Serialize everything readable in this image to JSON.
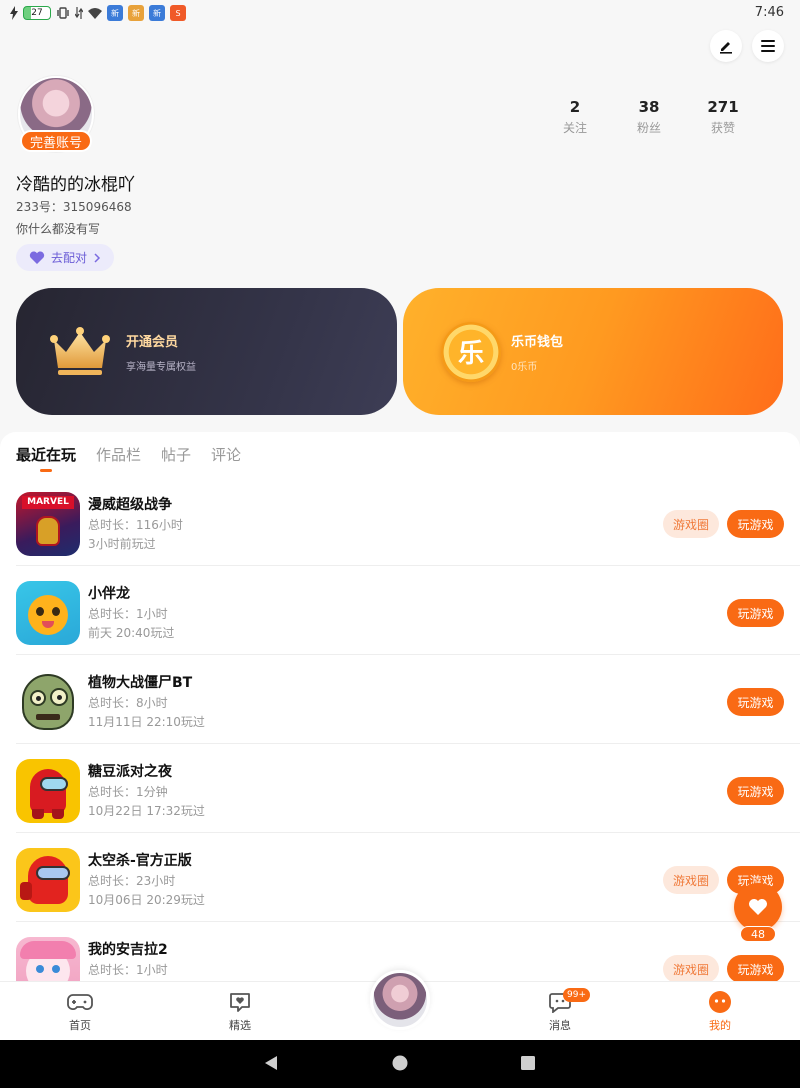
{
  "status_bar": {
    "battery": "27",
    "time": "7:46",
    "icons": [
      "charging-icon",
      "vibrate-icon",
      "data-icon",
      "wifi-icon"
    ],
    "apps": [
      {
        "label": "新",
        "color": "#3b7bd8"
      },
      {
        "label": "新",
        "color": "#e8a23b"
      },
      {
        "label": "新",
        "color": "#3b7bd8"
      },
      {
        "label": "S",
        "color": "#f05a28"
      }
    ]
  },
  "header": {
    "edit_icon": "pencil-icon",
    "menu_icon": "menu-icon"
  },
  "profile": {
    "badge": "完善账号",
    "nickname": "冷酷的的冰棍吖",
    "uid": "233号：315096468",
    "bio": "你什么都没有写",
    "pair_button": "去配对",
    "stats": [
      {
        "value": "2",
        "label": "关注"
      },
      {
        "value": "38",
        "label": "粉丝"
      },
      {
        "value": "271",
        "label": "获赞"
      }
    ]
  },
  "cards": {
    "vip": {
      "title": "开通会员",
      "subtitle": "享海量专属权益"
    },
    "wallet": {
      "title": "乐币钱包",
      "subtitle": "0乐币",
      "coin_char": "乐"
    }
  },
  "tabs": [
    {
      "label": "最近在玩",
      "active": true
    },
    {
      "label": "作品栏",
      "active": false
    },
    {
      "label": "帖子",
      "active": false
    },
    {
      "label": "评论",
      "active": false
    }
  ],
  "games": [
    {
      "name": "漫威超级战争",
      "duration": "总时长：116小时",
      "last_played": "3小时前玩过",
      "has_circle": true
    },
    {
      "name": "小伴龙",
      "duration": "总时长：1小时",
      "last_played": "前天 20:40玩过",
      "has_circle": false
    },
    {
      "name": "植物大战僵尸BT",
      "duration": "总时长：8小时",
      "last_played": "11月11日 22:10玩过",
      "has_circle": false
    },
    {
      "name": "糖豆派对之夜",
      "duration": "总时长：1分钟",
      "last_played": "10月22日 17:32玩过",
      "has_circle": false
    },
    {
      "name": "太空杀-官方正版",
      "duration": "总时长：23小时",
      "last_played": "10月06日 20:29玩过",
      "has_circle": true
    },
    {
      "name": "我的安吉拉2",
      "duration": "总时长：1小时",
      "last_played": "",
      "has_circle": true
    }
  ],
  "buttons": {
    "play": "玩游戏",
    "circle": "游戏圈"
  },
  "fab": {
    "like_count": "48"
  },
  "bottom_nav": {
    "items": [
      {
        "label": "首页",
        "icon": "gamepad-icon",
        "active": false
      },
      {
        "label": "精选",
        "icon": "heart-chat-icon",
        "active": false
      },
      {
        "label": "消息",
        "icon": "message-icon",
        "active": false,
        "badge": "99+"
      },
      {
        "label": "我的",
        "icon": "face-icon",
        "active": true
      }
    ]
  },
  "colors": {
    "accent": "#f96a14",
    "vip_bg": "#2d2c3c",
    "wallet_bg": "#ff9a20",
    "pair_bg": "#ecebfb"
  }
}
